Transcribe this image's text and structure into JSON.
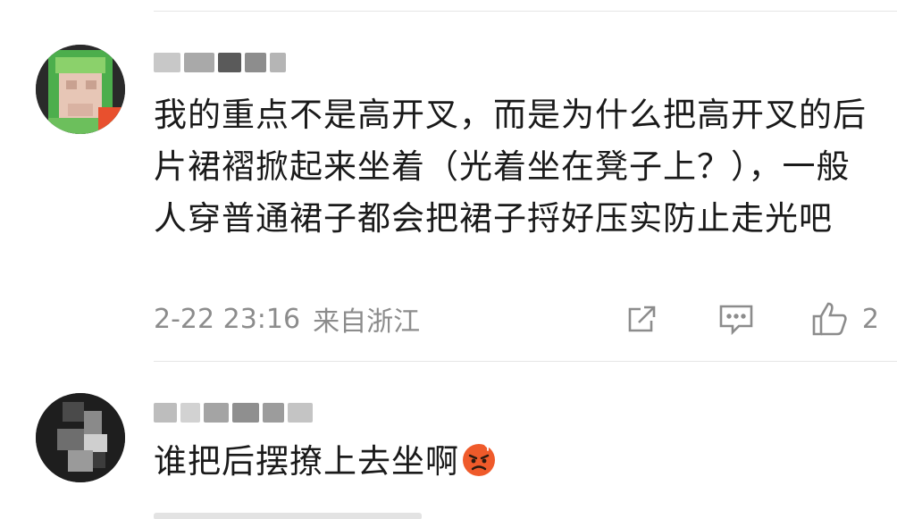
{
  "comments": [
    {
      "username": "",
      "text": "我的重点不是高开叉，而是为什么把高开叉的后片裙褶掀起来坐着（光着坐在凳子上？），一般人穿普通裙子都会把裙子捋好压实防止走光吧",
      "timestamp": "2-22 23:16",
      "location": "来自浙江",
      "like_count": "2",
      "has_verified_badge": true
    },
    {
      "username": "",
      "text": "谁把后摆撩上去坐啊",
      "emoji": "angry-face",
      "timestamp": "",
      "location": "",
      "like_count": ""
    }
  ],
  "icons": {
    "share": "share-icon",
    "reply": "comment-icon",
    "like": "thumb-up-icon"
  },
  "colors": {
    "text": "#1a1a1a",
    "meta": "#8c8c8c",
    "divider": "#e6e6e6",
    "badge": "#e8502e"
  }
}
